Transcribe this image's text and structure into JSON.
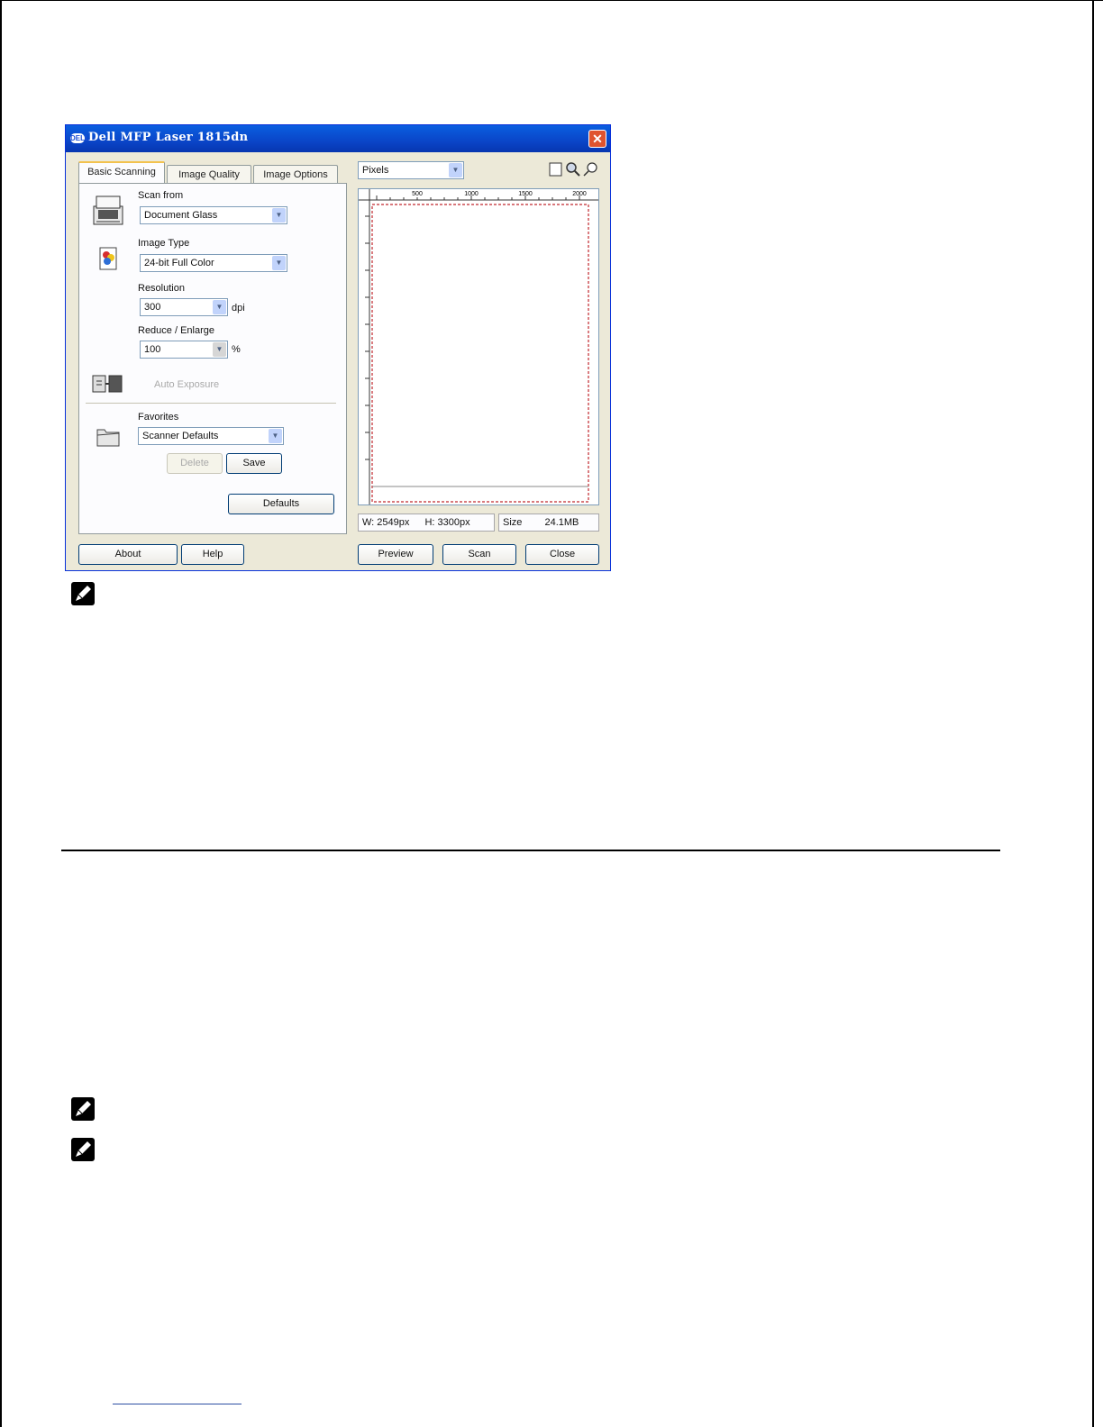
{
  "dialog": {
    "title": "Dell MFP Laser 1815dn",
    "tabs": [
      {
        "label": "Basic Scanning"
      },
      {
        "label": "Image Quality"
      },
      {
        "label": "Image Options"
      }
    ],
    "scan_from": {
      "label": "Scan from",
      "value": "Document Glass"
    },
    "image_type": {
      "label": "Image Type",
      "value": "24-bit Full Color"
    },
    "resolution": {
      "label": "Resolution",
      "value": "300",
      "unit": "dpi"
    },
    "reduce_enlarge": {
      "label": "Reduce / Enlarge",
      "value": "100",
      "unit": "%"
    },
    "auto_exposure": {
      "label": "Auto Exposure"
    },
    "favorites": {
      "label": "Favorites",
      "value": "Scanner Defaults"
    },
    "delete_label": "Delete",
    "save_label": "Save",
    "defaults_label": "Defaults",
    "units": {
      "value": "Pixels"
    },
    "ruler_ticks": [
      "500",
      "1000",
      "1500",
      "2000"
    ],
    "status": {
      "width": "W: 2549px",
      "height": "H: 3300px",
      "size_label": "Size",
      "size_value": "24.1MB"
    },
    "buttons": {
      "about": "About",
      "help": "Help",
      "preview": "Preview",
      "scan": "Scan",
      "close": "Close"
    }
  },
  "colors": {
    "titlebar": "#0a4fd4",
    "frame_red": "#c0272d"
  }
}
